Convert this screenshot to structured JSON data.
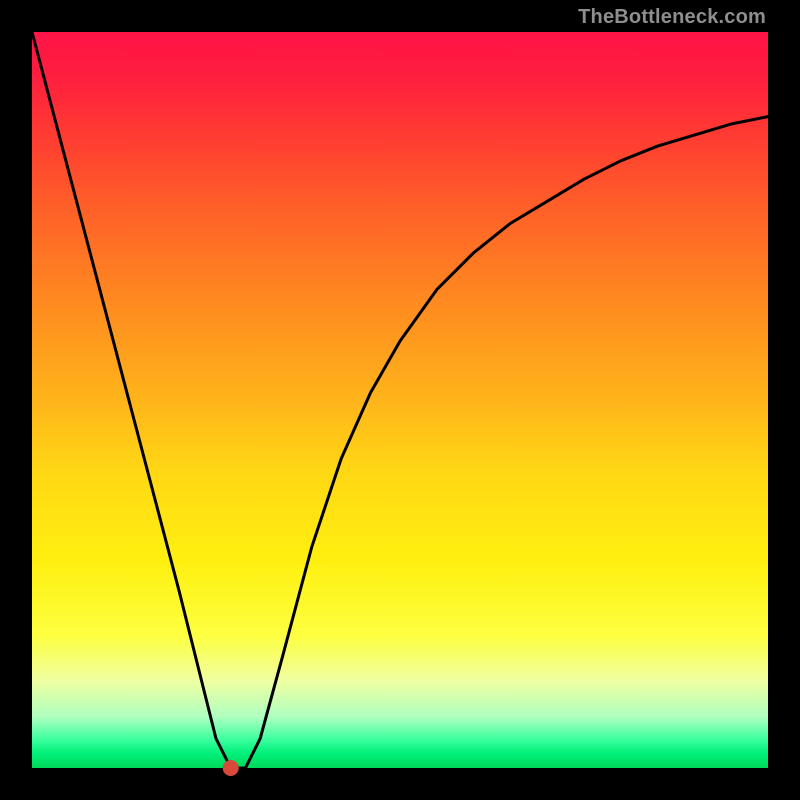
{
  "watermark": "TheBottleneck.com",
  "chart_data": {
    "type": "line",
    "title": "",
    "xlabel": "",
    "ylabel": "",
    "xlim": [
      0,
      100
    ],
    "ylim": [
      0,
      100
    ],
    "series": [
      {
        "name": "curve",
        "x": [
          0,
          5,
          10,
          15,
          20,
          23,
          25,
          27,
          29,
          31,
          34,
          38,
          42,
          46,
          50,
          55,
          60,
          65,
          70,
          75,
          80,
          85,
          90,
          95,
          100
        ],
        "values": [
          100,
          81,
          62,
          43,
          24,
          12,
          4,
          0,
          0,
          4,
          15,
          30,
          42,
          51,
          58,
          65,
          70,
          74,
          77,
          80,
          82.5,
          84.5,
          86,
          87.5,
          88.5
        ]
      }
    ],
    "marker": {
      "x": 27,
      "y": 0,
      "color": "#d9493a",
      "radius_px": 8
    },
    "gradient_background": {
      "top": "#ff1448",
      "middle": "#ffd800",
      "bottom": "#00d85a"
    }
  }
}
